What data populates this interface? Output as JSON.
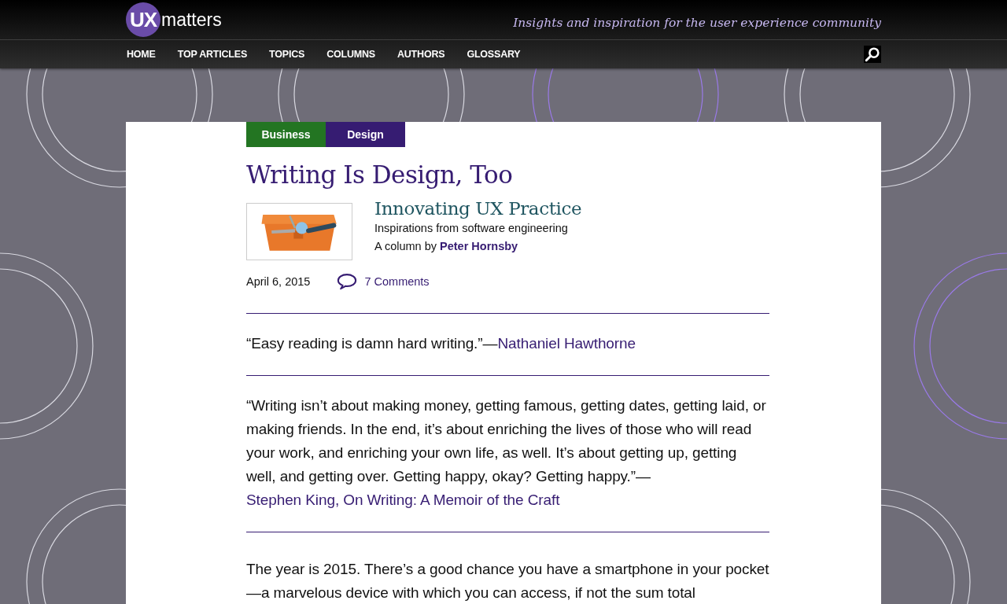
{
  "header": {
    "logo_mark": "UX",
    "logo_word": "matters",
    "tagline": "Insights and inspiration for the user experience community"
  },
  "nav": {
    "items": [
      "HOME",
      "TOP ARTICLES",
      "TOPICS",
      "COLUMNS",
      "AUTHORS",
      "GLOSSARY"
    ]
  },
  "article": {
    "categories": [
      {
        "label": "Business",
        "color": "#237522"
      },
      {
        "label": "Design",
        "color": "#361c72"
      }
    ],
    "title": "Writing Is Design, Too",
    "column": {
      "name": "Innovating UX Practice",
      "subtitle": "Inspirations from software engineering",
      "byline": "A column by",
      "author": "Peter Hornsby"
    },
    "date": "April 6, 2015",
    "comments": "7 Comments",
    "quotes": [
      {
        "text": "“Easy reading is damn hard writing.”—",
        "link": "Nathaniel Hawthorne"
      },
      {
        "text": "“Writing isn’t about making money, getting famous, getting dates, getting laid, or making friends. In the end, it’s about enriching the lives of those who will read your work, and enriching your own life, as well. It’s about getting up, getting well, and getting over. Getting happy, okay? Getting happy.”—",
        "link": "Stephen King, On Writing: A Memoir of the Craft"
      }
    ],
    "body": [
      "The year is 2015. There’s a good chance you have a smartphone in your pocket—a marvelous device with which you can access, if not the sum total"
    ]
  }
}
